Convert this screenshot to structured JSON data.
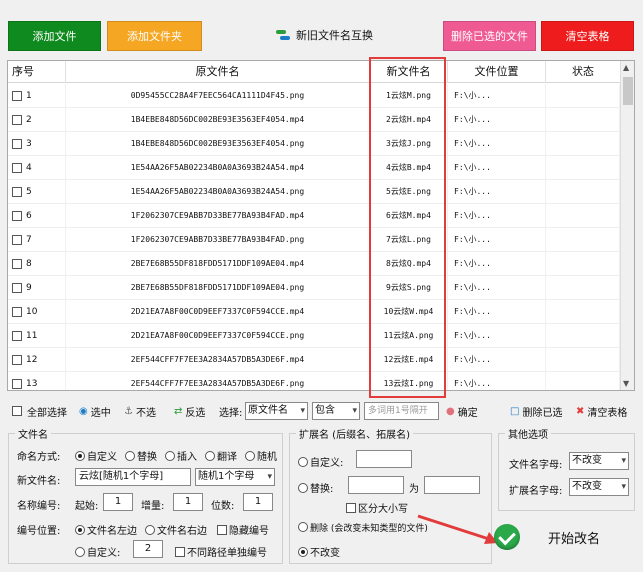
{
  "toolbar": {
    "add_file": "添加文件",
    "add_folder": "添加文件夹",
    "swap_names": "新旧文件名互换",
    "delete_selected_files": "删除已选的文件",
    "clear_table": "清空表格",
    "colors": {
      "green": "#0f8a1e",
      "orange": "#f5a623",
      "pink": "#f05a93",
      "red": "#ee1c1c"
    }
  },
  "table": {
    "headers": [
      "序号",
      "原文件名",
      "新文件名",
      "文件位置",
      "状态"
    ],
    "rows": [
      [
        "1",
        "0D95455CC28A4F7EEC564CA1111D4F45.png",
        "1云炫M.png",
        "F:\\小..."
      ],
      [
        "2",
        "1B4EBE848D56DC002BE93E3563EF4054.mp4",
        "2云炫H.mp4",
        "F:\\小..."
      ],
      [
        "3",
        "1B4EBE848D56DC002BE93E3563EF4054.png",
        "3云炫J.png",
        "F:\\小..."
      ],
      [
        "4",
        "1E54AA26F5AB02234B0A0A3693B24A54.mp4",
        "4云炫B.mp4",
        "F:\\小..."
      ],
      [
        "5",
        "1E54AA26F5AB02234B0A0A3693B24A54.png",
        "5云炫E.png",
        "F:\\小..."
      ],
      [
        "6",
        "1F2062307CE9ABB7D33BE77BA93B4FAD.mp4",
        "6云炫M.mp4",
        "F:\\小..."
      ],
      [
        "7",
        "1F2062307CE9ABB7D33BE77BA93B4FAD.png",
        "7云炫L.png",
        "F:\\小..."
      ],
      [
        "8",
        "2BE7E68B55DF818FDD5171DDF109AE04.mp4",
        "8云炫Q.mp4",
        "F:\\小..."
      ],
      [
        "9",
        "2BE7E68B55DF818FDD5171DDF109AE04.png",
        "9云炫S.png",
        "F:\\小..."
      ],
      [
        "10",
        "2D21EA7A8F00C0D9EEF7337C0F594CCE.mp4",
        "10云炫W.mp4",
        "F:\\小..."
      ],
      [
        "11",
        "2D21EA7A8F00C0D9EEF7337C0F594CCE.png",
        "11云炫A.png",
        "F:\\小..."
      ],
      [
        "12",
        "2EF544CFF7F7EE3A2834A57DB5A3DE6F.mp4",
        "12云炫E.mp4",
        "F:\\小..."
      ],
      [
        "13",
        "2EF544CFF7F7EE3A2834A57DB5A3DE6F.png",
        "13云炫I.png",
        "F:\\小..."
      ]
    ]
  },
  "actions": {
    "select_all": "全部选择",
    "select": "选中",
    "unselect": "不选",
    "invert": "反选",
    "choose_label": "选择:",
    "field_select": "原文件名",
    "match_select": "包含",
    "filter_placeholder": "多词用1号隔开",
    "confirm": "确定",
    "delete_selected": "删除已选",
    "clear_table": "清空表格"
  },
  "filename_panel": {
    "title": "文件名",
    "mode_label": "命名方式:",
    "modes": [
      "自定义",
      "替换",
      "插入",
      "翻译",
      "随机"
    ],
    "new_name_label": "新文件名:",
    "new_name_value": "云炫[随机1个字母]",
    "random_select": "随机1个字母",
    "numbering_label": "名称编号:",
    "start_label": "起始:",
    "start_value": "1",
    "step_label": "增量:",
    "step_value": "1",
    "digits_label": "位数:",
    "digits_value": "1",
    "position_label": "编号位置:",
    "position_left": "文件名左边",
    "position_right": "文件名右边",
    "hide_number": "隐藏编号",
    "custom_label": "自定义:",
    "custom_value": "2",
    "separate_paths": "不同路径单独编号"
  },
  "ext_panel": {
    "title": "扩展名 (后缀名、拓展名)",
    "custom": "自定义:",
    "replace": "替换:",
    "to": "为",
    "case_sensitive": "区分大小写",
    "delete": "删除 (会改变未知类型的文件)",
    "no_change": "不改变"
  },
  "other_panel": {
    "title": "其他选项",
    "filename_case_label": "文件名字母:",
    "filename_case_value": "不改变",
    "ext_case_label": "扩展名字母:",
    "ext_case_value": "不改变"
  },
  "start_button": "开始改名"
}
